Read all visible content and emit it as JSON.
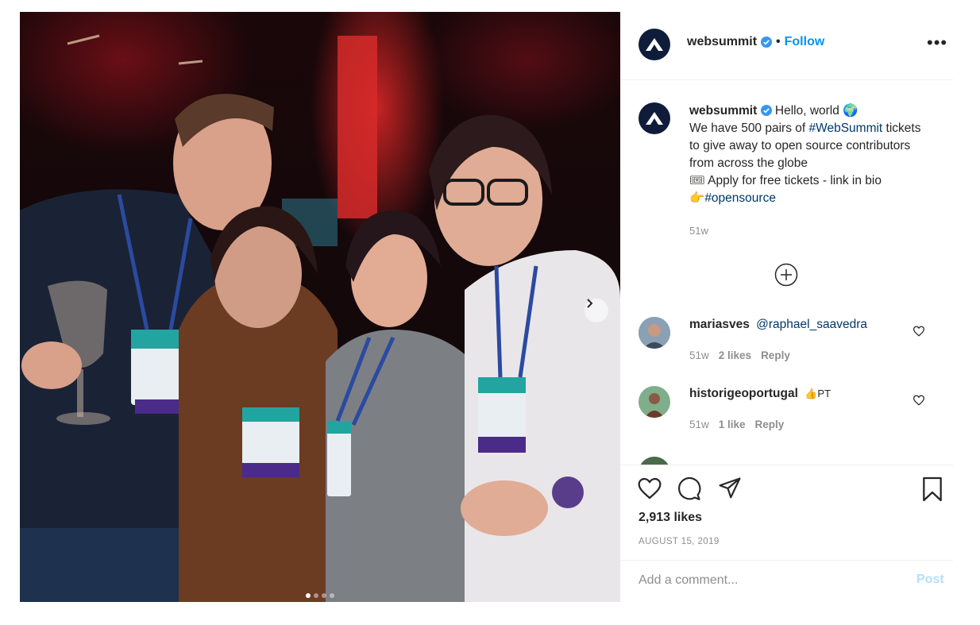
{
  "photo": {
    "alt": "",
    "carousel_dots": 4,
    "active_dot": 0
  },
  "header": {
    "username": "websummit",
    "separator": "•",
    "follow_label": "Follow",
    "more_label": "•••"
  },
  "caption": {
    "username": "websummit",
    "text_1": "Hello, world 🌍",
    "text_2": "We have 500 pairs of ",
    "hashtag_1": "#WebSummit",
    "text_3": " tickets to give away to open source contributors from across the globe",
    "text_4": "🎟 Apply for free tickets - link in bio",
    "text_5": "👉",
    "hashtag_2": "#opensource",
    "timestamp": "51w"
  },
  "comments": [
    {
      "username": "mariasves",
      "text": "@raphael_saavedra",
      "time": "51w",
      "likes": "2 likes",
      "reply": "Reply"
    },
    {
      "username": "historigeoportugal",
      "text": "👍PT",
      "time": "51w",
      "likes": "1 like",
      "reply": "Reply"
    }
  ],
  "actions": {
    "likes_count": "2,913 likes",
    "date": "AUGUST 15, 2019"
  },
  "add_comment": {
    "placeholder": "Add a comment...",
    "post_label": "Post"
  },
  "colors": {
    "accent": "#0095f6",
    "link": "#00376b",
    "muted": "#8e8e8e",
    "avatar_bg": "#0f1d3a"
  }
}
